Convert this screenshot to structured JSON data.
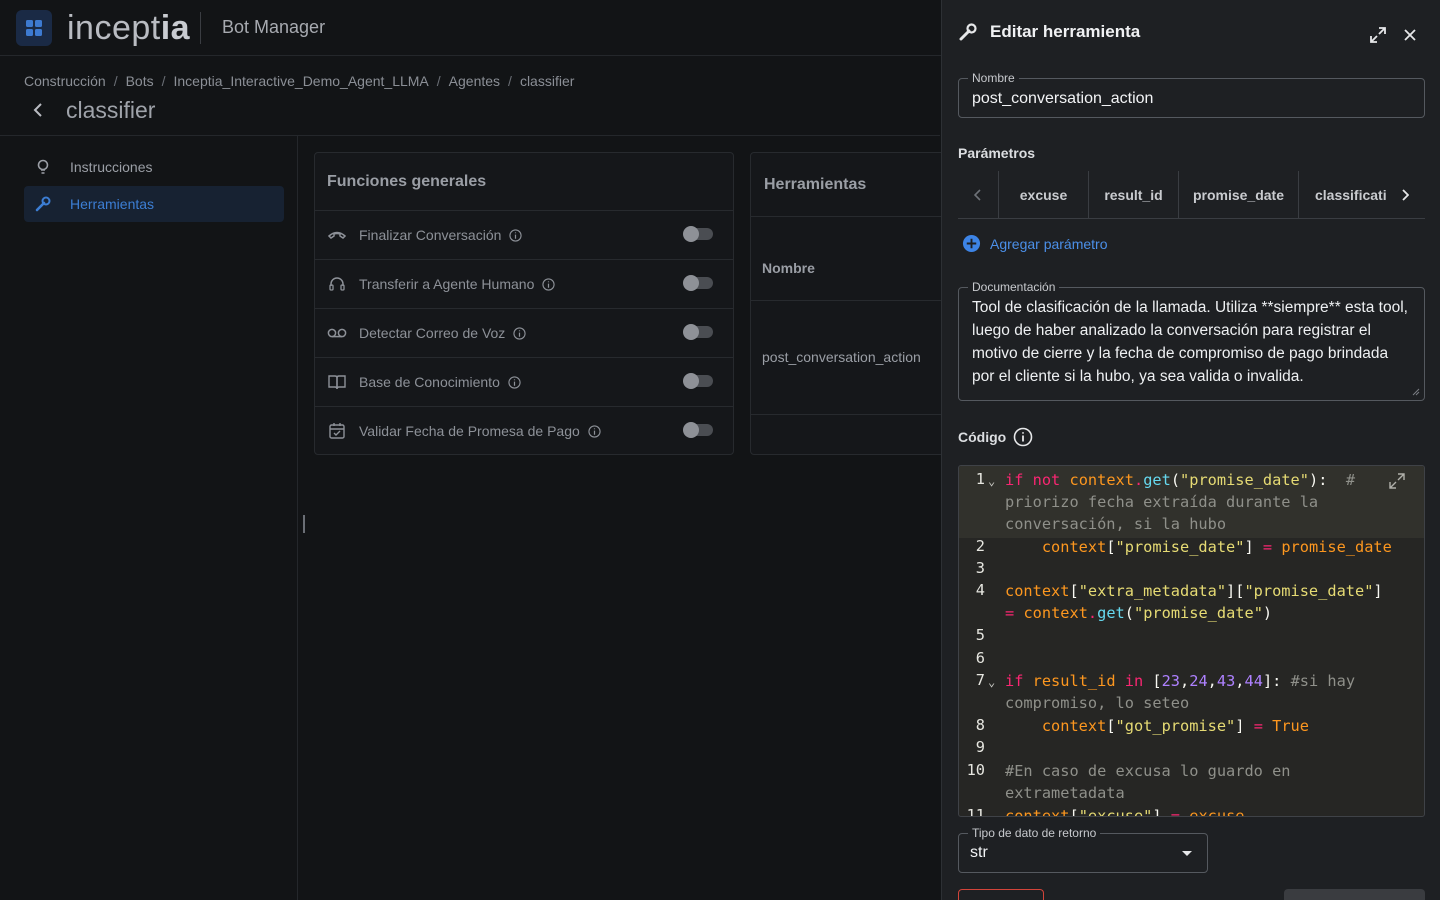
{
  "topbar": {
    "logo_light": "incept",
    "logo_bold": "ia",
    "product": "Bot Manager"
  },
  "breadcrumb": [
    "Construcción",
    "Bots",
    "Inceptia_Interactive_Demo_Agent_LLMA",
    "Agentes",
    "classifier"
  ],
  "breadcrumb_sep": "/",
  "page_title": "classifier",
  "sidebar": {
    "items": [
      {
        "label": "Instrucciones",
        "icon": "lightbulb-icon"
      },
      {
        "label": "Herramientas",
        "icon": "wrench-icon"
      }
    ]
  },
  "general_functions": {
    "title": "Funciones generales",
    "items": [
      {
        "label": "Finalizar Conversación",
        "icon": "phone-hangup-icon"
      },
      {
        "label": "Transferir a Agente Humano",
        "icon": "headset-icon"
      },
      {
        "label": "Detectar Correo de Voz",
        "icon": "voicemail-icon"
      },
      {
        "label": "Base de Conocimiento",
        "icon": "book-icon"
      },
      {
        "label": "Validar Fecha de Promesa de Pago",
        "icon": "calendar-check-icon"
      }
    ]
  },
  "tools_card": {
    "title": "Herramientas",
    "column_name": "Nombre",
    "rows": [
      "post_conversation_action"
    ]
  },
  "drawer": {
    "title": "Editar herramienta",
    "name_label": "Nombre",
    "name_value": "post_conversation_action",
    "params_label": "Parámetros",
    "param_tabs": [
      "excuse",
      "result_id",
      "promise_date",
      "classificati"
    ],
    "add_param": "Agregar parámetro",
    "doc_label": "Documentación",
    "doc_value": "Tool de clasificación de la llamada. Utiliza **siempre** esta tool, luego de haber analizado la conversación para registrar el motivo de cierre y la fecha de compromiso de pago brindada por el cliente si la hubo, ya sea valida o invalida.",
    "code_label": "Código",
    "return_label": "Tipo de dato de retorno",
    "return_value": "str"
  },
  "code": {
    "line_numbers": [
      "1",
      "2",
      "3",
      "4",
      "5",
      "6",
      "7",
      "8",
      "9",
      "10",
      "11"
    ]
  },
  "colors": {
    "accent": "#3c7ed4",
    "drawer_bg": "#1e2023",
    "code_bg": "#262624"
  }
}
